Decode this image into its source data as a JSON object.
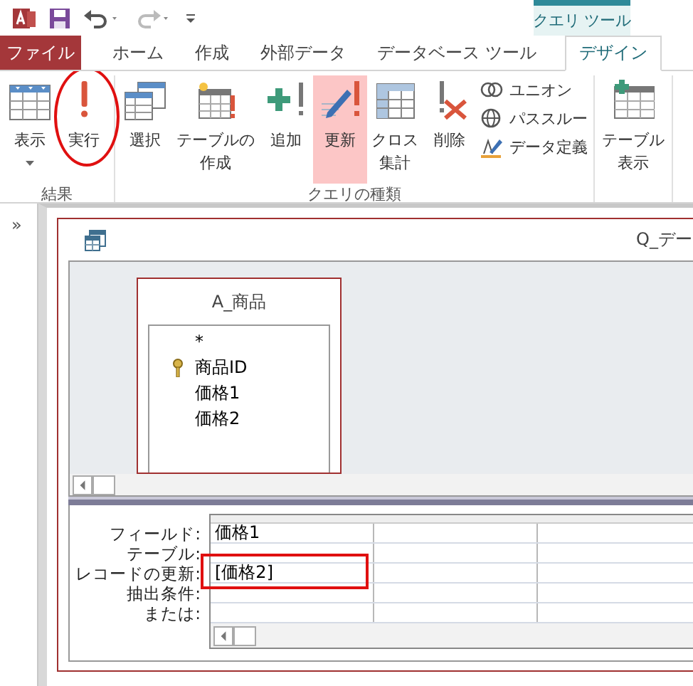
{
  "quick_access": {
    "undo_enabled": true,
    "redo_enabled": false
  },
  "contextual_tab": {
    "label": "クエリ ツール"
  },
  "tabs": [
    {
      "label": "ファイル",
      "kind": "file",
      "selected": false
    },
    {
      "label": "ホーム",
      "kind": "normal",
      "selected": false
    },
    {
      "label": "作成",
      "kind": "normal",
      "selected": false
    },
    {
      "label": "外部データ",
      "kind": "normal",
      "selected": false
    },
    {
      "label": "データベース ツール",
      "kind": "normal",
      "selected": false
    },
    {
      "label": "デザイン",
      "kind": "contextual",
      "selected": true
    }
  ],
  "ribbon": {
    "groups": [
      {
        "label": "結果",
        "buttons": [
          {
            "label": "表示",
            "kind": "large",
            "dropdown": true,
            "selected": false,
            "circled": false
          },
          {
            "label": "実行",
            "kind": "large",
            "selected": false,
            "circled": true
          }
        ]
      },
      {
        "label": "クエリの種類",
        "buttons": [
          {
            "label": "選択",
            "kind": "large",
            "selected": false,
            "circled": false
          },
          {
            "label": "テーブルの作成",
            "kind": "large",
            "selected": false,
            "circled": false
          },
          {
            "label": "追加",
            "kind": "large",
            "selected": false,
            "circled": false
          },
          {
            "label": "更新",
            "kind": "large",
            "selected": true,
            "circled": false
          },
          {
            "label": "クロス集計",
            "kind": "large",
            "selected": false,
            "circled": false
          },
          {
            "label": "削除",
            "kind": "large",
            "selected": false,
            "circled": false
          },
          {
            "label": "ユニオン",
            "kind": "small",
            "selected": false,
            "circled": false
          },
          {
            "label": "パススルー",
            "kind": "small",
            "selected": false,
            "circled": false
          },
          {
            "label": "データ定義",
            "kind": "small",
            "selected": false,
            "circled": false
          }
        ]
      },
      {
        "buttons": [
          {
            "label": "テーブル表示",
            "kind": "large",
            "selected": false,
            "circled": false
          }
        ]
      }
    ]
  },
  "navigation_pane": {
    "toggle": "»",
    "expanded": false
  },
  "query_window": {
    "title": "Q_デー",
    "tables": [
      {
        "name": "A_商品",
        "fields": [
          {
            "name": "*",
            "primary_key": false
          },
          {
            "name": "商品ID",
            "primary_key": true
          },
          {
            "name": "価格1",
            "primary_key": false
          },
          {
            "name": "価格2",
            "primary_key": false
          }
        ]
      }
    ],
    "grid": {
      "rows": [
        {
          "label": "フィールド:",
          "cells": [
            {
              "text": "価格1",
              "boxed": false
            }
          ]
        },
        {
          "label": "テーブル:"
        },
        {
          "label": "レコードの更新:",
          "cells": [
            {
              "text": "[価格2]",
              "boxed": true
            }
          ]
        },
        {
          "label": "抽出条件:"
        },
        {
          "label": "または:"
        }
      ]
    }
  }
}
